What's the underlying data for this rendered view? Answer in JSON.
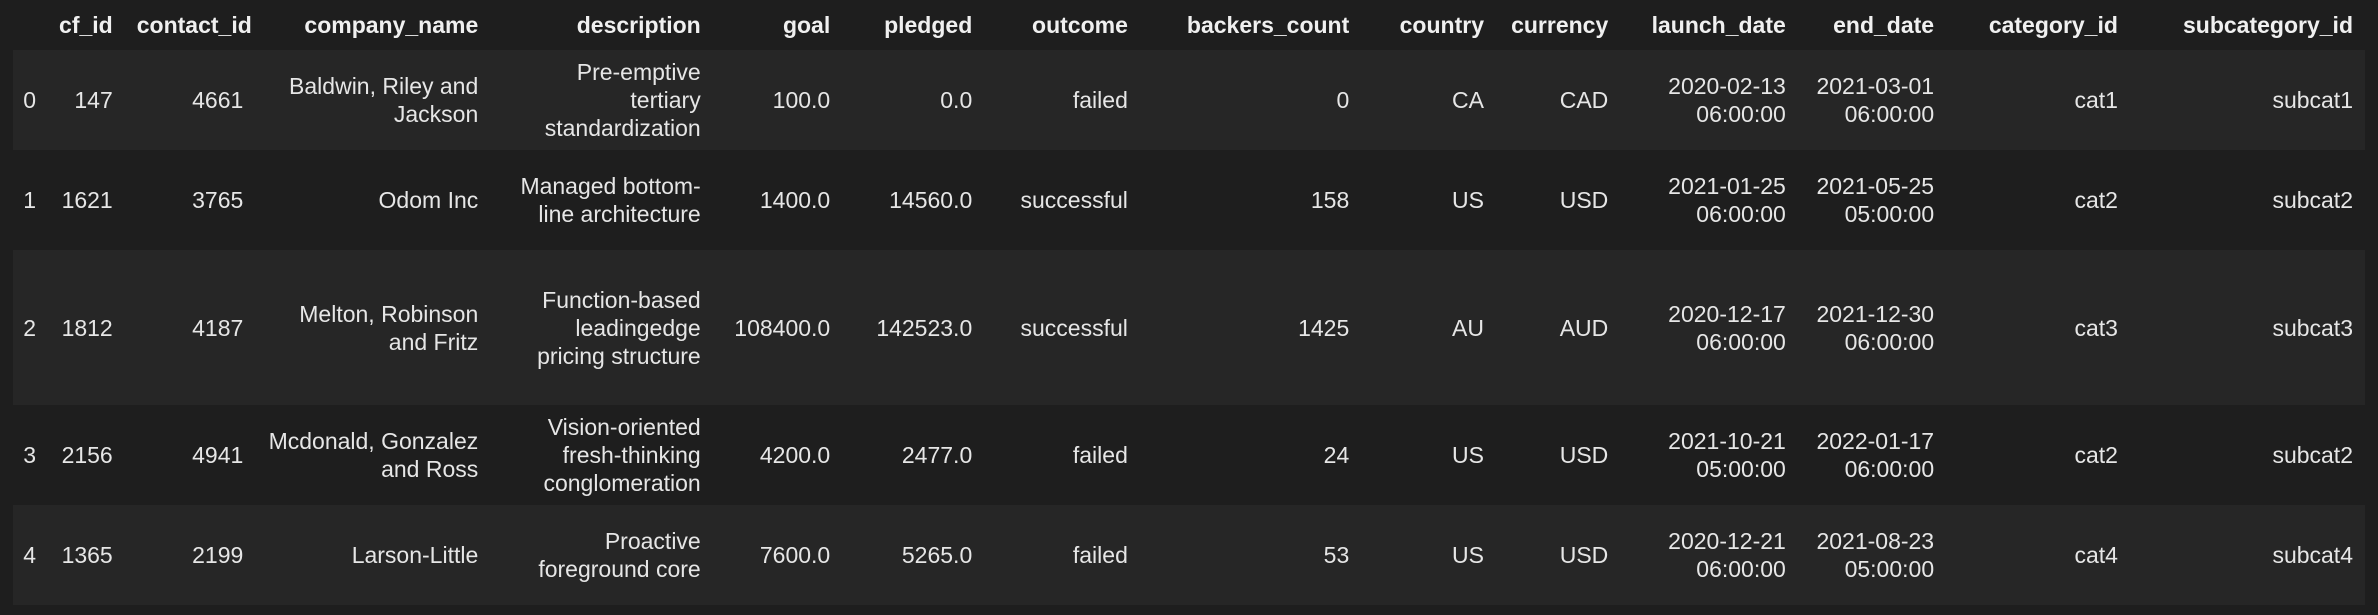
{
  "table": {
    "columns": [
      "",
      "cf_id",
      "contact_id",
      "company_name",
      "description",
      "goal",
      "pledged",
      "outcome",
      "backers_count",
      "country",
      "currency",
      "launch_date",
      "end_date",
      "category_id",
      "subcategory_id"
    ],
    "rows": [
      {
        "index": "0",
        "cf_id": "147",
        "contact_id": "4661",
        "company_name": "Baldwin, Riley and Jackson",
        "description": "Pre-emptive tertiary standardization",
        "goal": "100.0",
        "pledged": "0.0",
        "outcome": "failed",
        "backers_count": "0",
        "country": "CA",
        "currency": "CAD",
        "launch_date": "2020-02-13 06:00:00",
        "end_date": "2021-03-01 06:00:00",
        "category_id": "cat1",
        "subcategory_id": "subcat1"
      },
      {
        "index": "1",
        "cf_id": "1621",
        "contact_id": "3765",
        "company_name": "Odom Inc",
        "description": "Managed bottom-line architecture",
        "goal": "1400.0",
        "pledged": "14560.0",
        "outcome": "successful",
        "backers_count": "158",
        "country": "US",
        "currency": "USD",
        "launch_date": "2021-01-25 06:00:00",
        "end_date": "2021-05-25 05:00:00",
        "category_id": "cat2",
        "subcategory_id": "subcat2"
      },
      {
        "index": "2",
        "cf_id": "1812",
        "contact_id": "4187",
        "company_name": "Melton, Robinson and Fritz",
        "description": "Function-based leadingedge pricing structure",
        "goal": "108400.0",
        "pledged": "142523.0",
        "outcome": "successful",
        "backers_count": "1425",
        "country": "AU",
        "currency": "AUD",
        "launch_date": "2020-12-17 06:00:00",
        "end_date": "2021-12-30 06:00:00",
        "category_id": "cat3",
        "subcategory_id": "subcat3"
      },
      {
        "index": "3",
        "cf_id": "2156",
        "contact_id": "4941",
        "company_name": "Mcdonald, Gonzalez and Ross",
        "description": "Vision-oriented fresh-thinking conglomeration",
        "goal": "4200.0",
        "pledged": "2477.0",
        "outcome": "failed",
        "backers_count": "24",
        "country": "US",
        "currency": "USD",
        "launch_date": "2021-10-21 05:00:00",
        "end_date": "2022-01-17 06:00:00",
        "category_id": "cat2",
        "subcategory_id": "subcat2"
      },
      {
        "index": "4",
        "cf_id": "1365",
        "contact_id": "2199",
        "company_name": "Larson-Little",
        "description": "Proactive foreground core",
        "goal": "7600.0",
        "pledged": "5265.0",
        "outcome": "failed",
        "backers_count": "53",
        "country": "US",
        "currency": "USD",
        "launch_date": "2020-12-21 06:00:00",
        "end_date": "2021-08-23 05:00:00",
        "category_id": "cat4",
        "subcategory_id": "subcat4"
      }
    ]
  },
  "colors": {
    "background": "#1e1e1e",
    "stripe": "#262626",
    "text": "#e6e6e6"
  }
}
